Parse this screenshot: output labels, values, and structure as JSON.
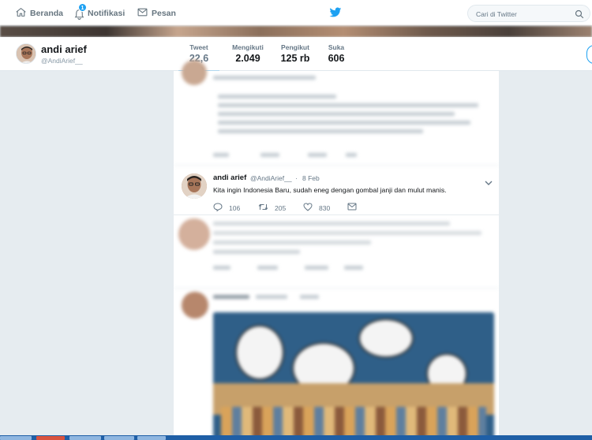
{
  "nav": {
    "home_label": "Beranda",
    "notifications_label": "Notifikasi",
    "notifications_count": "1",
    "messages_label": "Pesan",
    "search_placeholder": "Cari di Twitter"
  },
  "profile": {
    "name": "andi arief",
    "handle": "@AndiArief__",
    "stats": [
      {
        "label": "Tweet",
        "value": "22,6 rb"
      },
      {
        "label": "Mengikuti",
        "value": "2.049"
      },
      {
        "label": "Pengikut",
        "value": "125 rb"
      },
      {
        "label": "Suka",
        "value": "606"
      }
    ]
  },
  "tweet": {
    "name": "andi arief",
    "handle": "@AndiArief__",
    "separator": "·",
    "time": "8 Feb",
    "text": "Kita ingin Indonesia Baru, sudah eneg dengan gombal janji dan mulut manis.",
    "replies": "106",
    "retweets": "205",
    "likes": "830"
  },
  "colors": {
    "accent": "#1da1f2",
    "background": "#e6ecf0",
    "muted_text": "#657786"
  },
  "icons": {
    "home": "home-icon",
    "notifications": "bell-icon",
    "messages": "envelope-icon",
    "logo": "twitter-bird-icon",
    "search": "search-icon",
    "reply": "reply-icon",
    "retweet": "retweet-icon",
    "like": "heart-icon",
    "dm": "envelope-icon",
    "more": "chevron-down-icon"
  }
}
